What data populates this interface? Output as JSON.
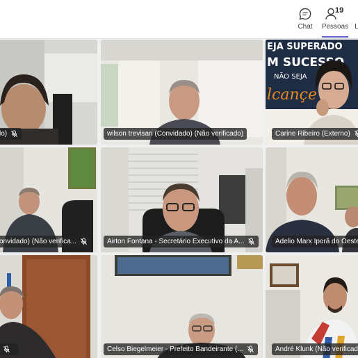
{
  "header": {
    "chat_label": "Chat",
    "people_label": "Pessoas",
    "people_count": "19",
    "cut_label": "L",
    "chat_icon": "chat-bubble-icon",
    "people_icon": "person-icon",
    "accent": "#5b5fc7"
  },
  "participants": [
    {
      "name": "lo)"
    },
    {
      "name": "wilson trevisan (Convidado) (Não verificado)"
    },
    {
      "name": "Carine Ribeiro (Externo)"
    },
    {
      "name": "onvidado) (Não verifica..."
    },
    {
      "name": "Airton Fontana - Secretário Executivo da A..."
    },
    {
      "name": "Adelio Marx Iporã do Oeste (E"
    },
    {
      "name": ""
    },
    {
      "name": "Celso Biegelmeier - Prefeito Bandeirante (..."
    },
    {
      "name": "André Klunk (Não verificado)"
    }
  ],
  "backgrounds": {
    "carine_banner_lines": [
      "EJA SUPERADO",
      "M SUCESSO",
      "NÃO SEJA",
      "lcançe"
    ]
  },
  "muted_icon": "mic-muted-icon"
}
